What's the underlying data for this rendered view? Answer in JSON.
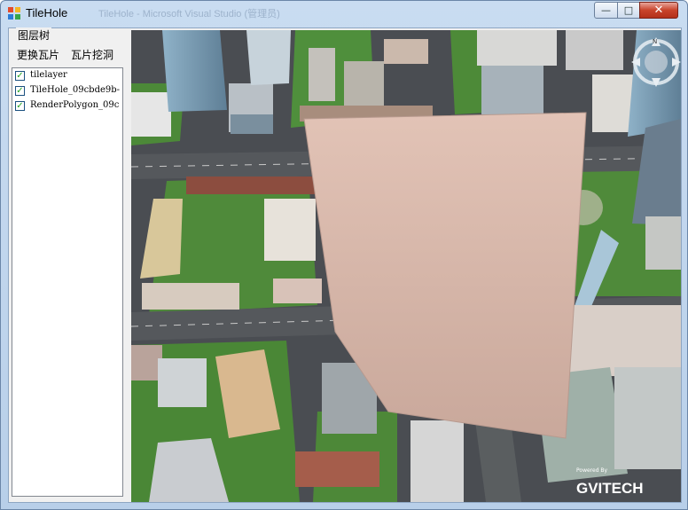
{
  "window": {
    "title": "TileHole",
    "ghost_title": "TileHole - Microsoft Visual Studio (管理员)"
  },
  "controls": {
    "minimize": "—",
    "maximize": "□",
    "close": "✕"
  },
  "panel": {
    "group_label": "图层树",
    "buttons": {
      "replace_tile": "更换瓦片",
      "dig_tile": "瓦片挖洞"
    },
    "layers": [
      {
        "label": "tilelayer",
        "checked": true
      },
      {
        "label": "TileHole_09cbde9b-",
        "checked": true
      },
      {
        "label": "RenderPolygon_09c",
        "checked": true
      }
    ]
  },
  "scene": {
    "brand_small": "Powered By",
    "brand": "GVITECH",
    "compass_label": "N",
    "colors": {
      "road": "#4a4d52",
      "grass": "#4f8a3a",
      "polygon": "#d2b2a6"
    }
  }
}
